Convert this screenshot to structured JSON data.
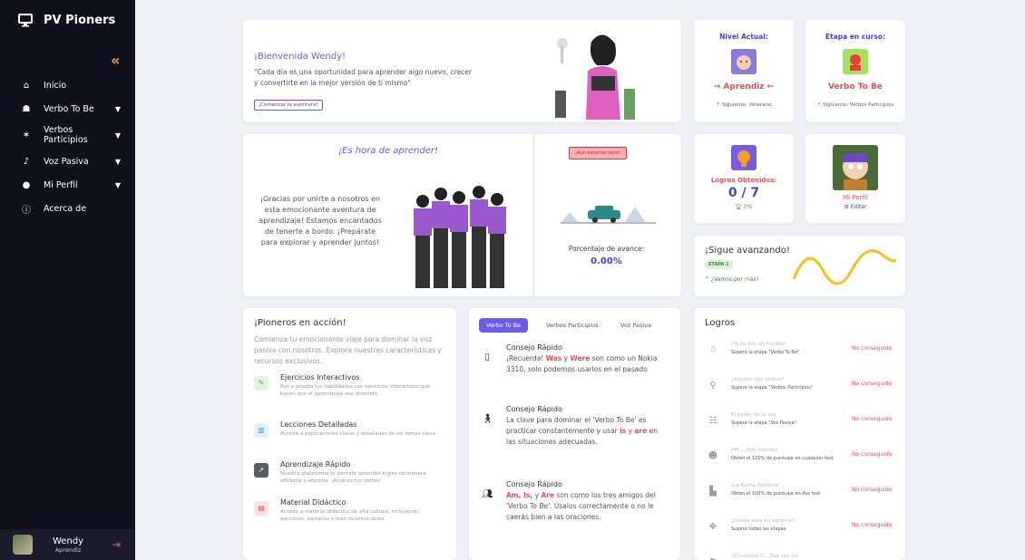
{
  "app": {
    "title": "PV Pioners"
  },
  "sidebar": {
    "items": [
      {
        "label": "Inicio",
        "icon": "home-icon"
      },
      {
        "label": "Verbo To Be",
        "icon": "people-icon"
      },
      {
        "label": "Verbos Participios",
        "icon": "running-icon"
      },
      {
        "label": "Voz Pasiva",
        "icon": "voice-icon"
      },
      {
        "label": "Mi Perfil",
        "icon": "user-icon"
      },
      {
        "label": "Acerca de",
        "icon": "info-icon"
      }
    ],
    "user": {
      "name": "Wendy",
      "role": "Aprendiz"
    }
  },
  "welcome": {
    "title": "¡Bienvenida Wendy!",
    "quote": "\"Cada día es una oportunidad para aprender algo nuevo, crecer y convertirte en la mejor versión de ti mismo\"",
    "button": "¡Comenzar la aventura!"
  },
  "level": {
    "title": "Nivel Actual:",
    "value": "→ Aprendiz ←",
    "next": "↑ Siguiente: Veterano"
  },
  "stage": {
    "title": "Etapa en curso:",
    "value": "Verbo To Be",
    "next": "↑ Siguiente: Verbos Participios"
  },
  "learn": {
    "title": "¡Es hora de aprender!",
    "text": "¡Gracias por unirte a nosotros en esta emocionante aventura de aprendizaje! Estamos encantados de tenerte a bordo. ¡Prepárate para explorar y aprender juntos!",
    "button": "¡Aún estamos lejos!",
    "progress_label": "Porcentaje de avance:",
    "progress_value": "0.00%",
    "progress": 0
  },
  "achievements": {
    "label": "Logros Obtenidos:",
    "count": "0 / 7",
    "pct": "0%"
  },
  "profile": {
    "label": "Mi Perfil",
    "edit": "Editar"
  },
  "keep": {
    "title": "¡Sigue avanzando!",
    "stage": "ETAPA 1",
    "link": "^ ¿Vamos por más?"
  },
  "pioneers": {
    "title": "¡Pioneros en acción!",
    "text": "Comienza tu emocionante viaje para dominar la voz pasiva con nosotros. Explora nuestras características y recursos exclusivos.",
    "features": [
      {
        "title": "Ejercicios Interactivos",
        "desc": "Pon a prueba tus habilidades con ejercicios interactivos que hacen que el aprendizaje sea divertido.",
        "icon": "pencil-icon",
        "color": "#e1f5e1",
        "fg": "#4caf50"
      },
      {
        "title": "Lecciones Detalladas",
        "desc": "Accede a explicaciones claras y detalladas de los temas clave.",
        "icon": "books-icon",
        "color": "#e0f2fa",
        "fg": "#3a9ad0"
      },
      {
        "title": "Aprendizaje Rápido",
        "desc": "Nuestra plataforma te permite aprender inglés de manera eficiente y efectiva. ¡Alcanza tus metas!",
        "icon": "rocket-icon",
        "color": "#555e66",
        "fg": "#ffffff"
      },
      {
        "title": "Material Didáctico",
        "desc": "Accede a material didáctico de alta calidad, incluyendo ejercicios, ejemplos y más recursos útiles.",
        "icon": "document-icon",
        "color": "#fde0e0",
        "fg": "#e05050"
      }
    ]
  },
  "tabs": [
    "Verbo To Be",
    "Verbos Participios",
    "Voz Pasiva"
  ],
  "tips": [
    {
      "title": "Consejo Rápido",
      "body_pre": "¡Recuerda! ",
      "hl1": "Was",
      "mid": " y ",
      "hl2": "Were",
      "body_post": " son como un Nokia 3310, solo podemos usarlos en el pasado",
      "icon": "phone-icon"
    },
    {
      "title": "Consejo Rápido",
      "body_pre": "La clave para dominar el 'Verbo To Be' es practicar constantemente y usar ",
      "hl1": "is",
      "mid": " y ",
      "hl2": "are",
      "body_post": " en las situaciones adecuadas.",
      "icon": "walker-icon"
    },
    {
      "title": "Consejo Rápido",
      "body_pre": "",
      "hl1": "Am, Is,",
      "mid": " y ",
      "hl2": "Are",
      "body_post": " son como los tres amigos del 'Verbo To Be'. Úsalos correctamente o no le caerás bien a las oraciones.",
      "icon": "friends-icon"
    }
  ],
  "logros": {
    "title": "Logros",
    "items": [
      {
        "title": "¡Ya no soy un novato!",
        "desc": "Supera la etapa \"Verbo To Be\"",
        "status": "No conseguido"
      },
      {
        "title": "¿Alguien dijo verbos?",
        "desc": "Supera la etapa \"Verbos Participios\"",
        "status": "No conseguido"
      },
      {
        "title": "El poder de la voz",
        "desc": "Supera la etapa \"Voz Pasiva\"",
        "status": "No conseguido"
      },
      {
        "title": "Pfff... ¡Pan comido!",
        "desc": "Obtén el 100% de puntuaje en cualquier test",
        "status": "No conseguido"
      },
      {
        "title": "¡La Racha Perfecta!",
        "desc": "Obtén el 100% de puntuaje en dos test",
        "status": "No conseguido"
      },
      {
        "title": "¿Donde está mi diploma?",
        "desc": "Supera todas las etapas",
        "status": "No conseguido"
      },
      {
        "title": "¡El número 1!, ¡Ese soy yo!",
        "desc": "",
        "status": ""
      }
    ]
  }
}
